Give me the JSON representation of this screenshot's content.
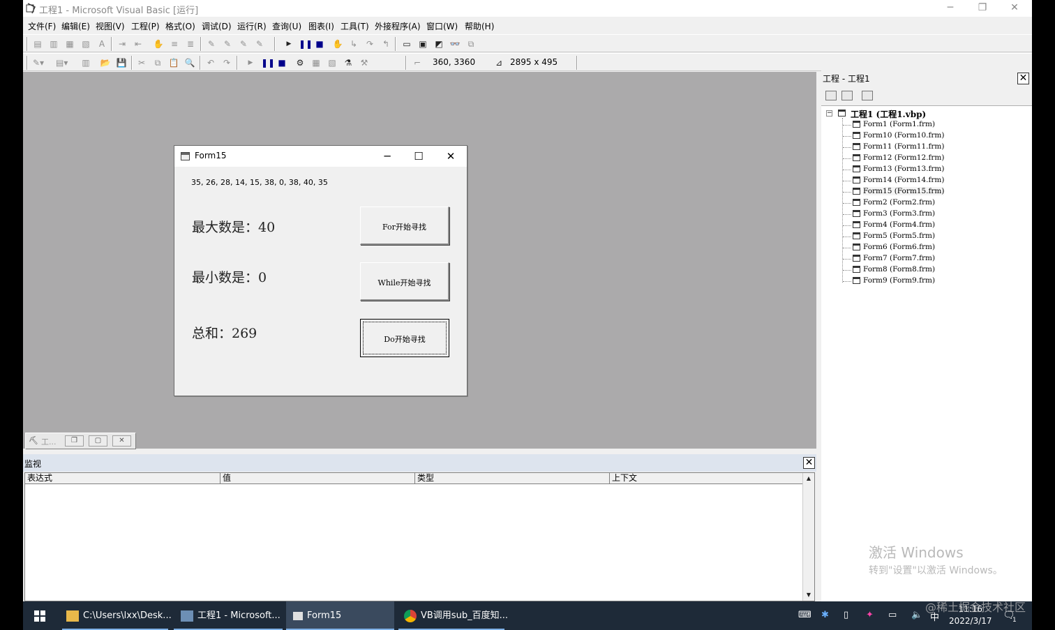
{
  "ide": {
    "title": "工程1 - Microsoft Visual Basic [运行]",
    "window_buttons": [
      "─",
      "❐",
      "✕"
    ],
    "menu": [
      "文件(F)",
      "编辑(E)",
      "视图(V)",
      "工程(P)",
      "格式(O)",
      "调试(D)",
      "运行(R)",
      "查询(U)",
      "图表(I)",
      "工具(T)",
      "外接程序(A)",
      "窗口(W)",
      "帮助(H)"
    ],
    "toolbar": {
      "position_readout": "360, 3360",
      "size_readout": "2895 x 495"
    }
  },
  "form15": {
    "title": "Form15",
    "controls": [
      "─",
      "☐",
      "✕"
    ],
    "numbers": "35, 26, 28, 14, 15, 38, 0, 38, 40, 35",
    "max_label": "最大数是：40",
    "min_label": "最小数是：0",
    "sum_label": "总和：269",
    "btn_for": "For开始寻找",
    "btn_while": "While开始寻找",
    "btn_do": "Do开始寻找"
  },
  "minimized_window": {
    "label": "工..."
  },
  "watch": {
    "title": "监视",
    "columns": [
      "表达式",
      "值",
      "类型",
      "上下文"
    ]
  },
  "project": {
    "title": "工程 - 工程1",
    "root": "工程1 (工程1.vbp)",
    "forms": [
      "Form1 (Form1.frm)",
      "Form10 (Form10.frm)",
      "Form11 (Form11.frm)",
      "Form12 (Form12.frm)",
      "Form13 (Form13.frm)",
      "Form14 (Form14.frm)",
      "Form15 (Form15.frm)",
      "Form2 (Form2.frm)",
      "Form3 (Form3.frm)",
      "Form4 (Form4.frm)",
      "Form5 (Form5.frm)",
      "Form6 (Form6.frm)",
      "Form7 (Form7.frm)",
      "Form8 (Form8.frm)",
      "Form9 (Form9.frm)"
    ],
    "selected": "Form15 (Form15.frm)"
  },
  "activation": {
    "line1": "激活 Windows",
    "line2": "转到\"设置\"以激活 Windows。"
  },
  "taskbar": {
    "items": [
      {
        "label": "C:\\Users\\lxx\\Desk...",
        "icon": "folder-icon"
      },
      {
        "label": "工程1 - Microsoft...",
        "icon": "vb-icon"
      },
      {
        "label": "Form15",
        "icon": "form-icon"
      },
      {
        "label": "VB调用sub_百度知...",
        "icon": "chrome-icon"
      }
    ],
    "ime": "中",
    "time": "11:16",
    "date": "2022/3/17",
    "notification_count": "1"
  },
  "watermark": "@稀土掘金技术社区",
  "colors": {
    "mdi_background": "#abaaab",
    "taskbar": "#1e2a38",
    "watch_header": "#dde4ee"
  }
}
